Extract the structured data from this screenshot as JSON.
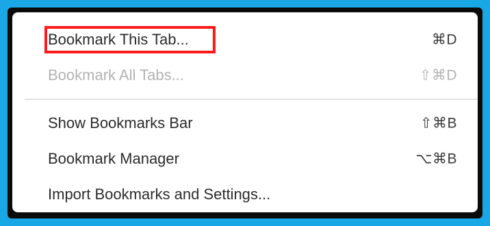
{
  "menu": {
    "items": [
      {
        "label": "Bookmark This Tab...",
        "shortcut": "⌘D",
        "enabled": true
      },
      {
        "label": "Bookmark All Tabs...",
        "shortcut": "⇧⌘D",
        "enabled": false
      },
      {
        "label": "Show Bookmarks Bar",
        "shortcut": "⇧⌘B",
        "enabled": true
      },
      {
        "label": "Bookmark Manager",
        "shortcut": "⌥⌘B",
        "enabled": true
      },
      {
        "label": "Import Bookmarks and Settings...",
        "shortcut": "",
        "enabled": true
      }
    ],
    "highlighted_item": "Bookmark This Tab..."
  },
  "colors": {
    "outer_border": "#1aa7e6",
    "inner_border": "#0b0b0b",
    "highlight": "#ff1a1a",
    "disabled_text": "#b3b3b3"
  }
}
